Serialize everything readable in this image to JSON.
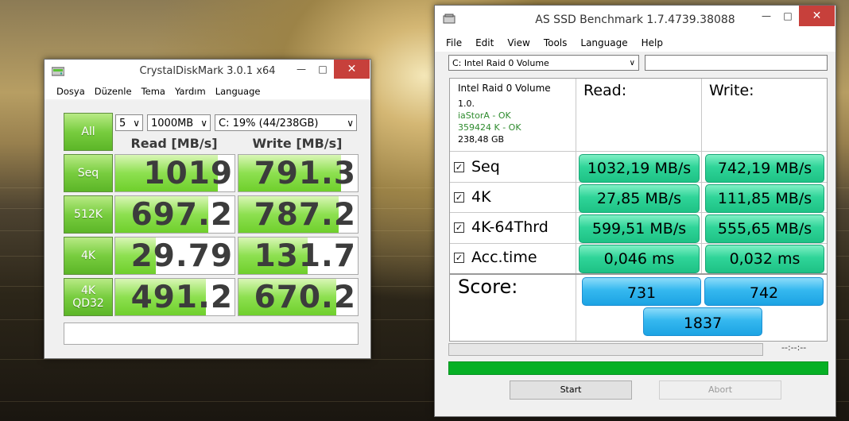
{
  "cdm": {
    "title": "CrystalDiskMark 3.0.1 x64",
    "menu": [
      "Dosya",
      "Düzenle",
      "Tema",
      "Yardım",
      "Language"
    ],
    "all_label": "All",
    "count": "5",
    "size": "1000MB",
    "drive": "C: 19% (44/238GB)",
    "read_header": "Read [MB/s]",
    "write_header": "Write [MB/s]",
    "rows": [
      {
        "label_a": "Seq",
        "label_b": "",
        "read": "1019",
        "write": "791.3",
        "read_fill": 0.86,
        "write_fill": 0.86
      },
      {
        "label_a": "512K",
        "label_b": "",
        "read": "697.2",
        "write": "787.2",
        "read_fill": 0.78,
        "write_fill": 0.84
      },
      {
        "label_a": "4K",
        "label_b": "",
        "read": "29.79",
        "write": "131.7",
        "read_fill": 0.34,
        "write_fill": 0.58
      },
      {
        "label_a": "4K",
        "label_b": "QD32",
        "read": "491.2",
        "write": "670.2",
        "read_fill": 0.76,
        "write_fill": 0.82
      }
    ],
    "status": ""
  },
  "asssd": {
    "title": "AS SSD Benchmark 1.7.4739.38088",
    "menu": [
      "File",
      "Edit",
      "View",
      "Tools",
      "Language",
      "Help"
    ],
    "drive_select": "C: Intel Raid 0 Volume",
    "drive_info": {
      "name": "Intel Raid 0 Volume",
      "firmware": "1.0.",
      "driver": "iaStorA - OK",
      "alignment": "359424 K - OK",
      "capacity": "238,48 GB"
    },
    "read_header": "Read:",
    "write_header": "Write:",
    "rows": [
      {
        "label": "Seq",
        "read": "1032,19 MB/s",
        "write": "742,19 MB/s"
      },
      {
        "label": "4K",
        "read": "27,85 MB/s",
        "write": "111,85 MB/s"
      },
      {
        "label": "4K-64Thrd",
        "read": "599,51 MB/s",
        "write": "555,65 MB/s"
      },
      {
        "label": "Acc.time",
        "read": "0,046 ms",
        "write": "0,032 ms"
      }
    ],
    "score_label": "Score:",
    "score_read": "731",
    "score_write": "742",
    "score_total": "1837",
    "timer": "--:--:--",
    "start_label": "Start",
    "abort_label": "Abort",
    "progress_value": 1.0
  }
}
